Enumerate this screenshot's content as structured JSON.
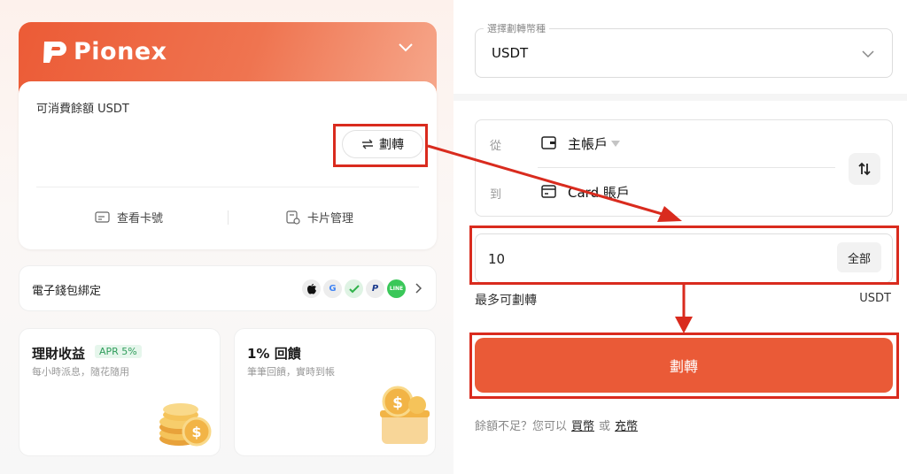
{
  "brand": {
    "name": "Pionex"
  },
  "card": {
    "balance_label": "可消費餘額 USDT",
    "transfer_label": "劃轉",
    "view_number_label": "查看卡號",
    "manage_label": "卡片管理"
  },
  "wallet": {
    "label": "電子錢包綁定",
    "pay_methods": [
      "apple-pay",
      "google-pay",
      "wechat-pay",
      "paypal",
      "line-pay"
    ],
    "line_text": "LINE"
  },
  "promos": [
    {
      "title": "理財收益",
      "badge": "APR 5%",
      "subtitle": "每小時派息，隨花隨用"
    },
    {
      "title": "1% 回饋",
      "subtitle": "筆筆回饋，實時到帳"
    }
  ],
  "transfer_form": {
    "currency_legend": "選擇劃轉幣種",
    "currency_value": "USDT",
    "from_label": "從",
    "from_value": "主帳戶",
    "to_label": "到",
    "to_value": "Card 賬戶",
    "amount_value": "10",
    "all_label": "全部",
    "max_label": "最多可劃轉",
    "max_unit": "USDT",
    "submit_label": "劃轉",
    "footer_text": "餘額不足？您可以",
    "buy_link": "買幣",
    "or_text": "或",
    "deposit_link": "充幣"
  },
  "colors": {
    "accent": "#ea5a37",
    "annotation": "#d92b1e"
  }
}
